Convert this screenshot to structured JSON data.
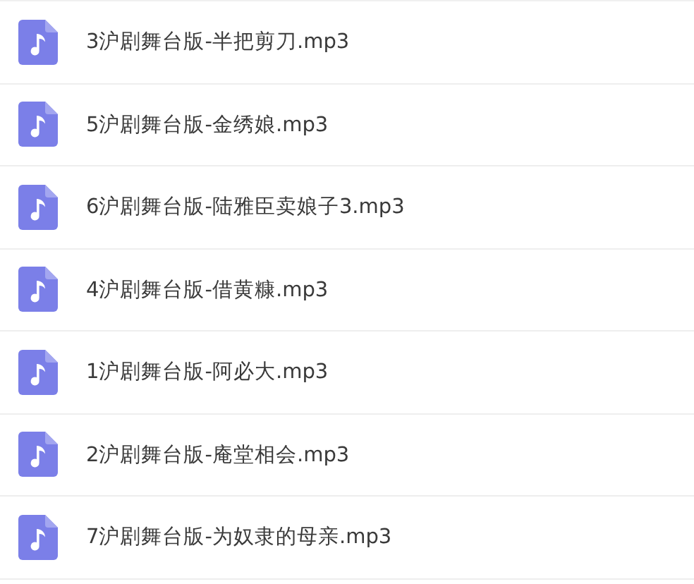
{
  "files": [
    {
      "name": "3沪剧舞台版-半把剪刀.mp3"
    },
    {
      "name": "5沪剧舞台版-金绣娘.mp3"
    },
    {
      "name": "6沪剧舞台版-陆雅臣卖娘子3.mp3"
    },
    {
      "name": "4沪剧舞台版-借黄糠.mp3"
    },
    {
      "name": "1沪剧舞台版-阿必大.mp3"
    },
    {
      "name": "2沪剧舞台版-庵堂相会.mp3"
    },
    {
      "name": "7沪剧舞台版-为奴隶的母亲.mp3"
    }
  ]
}
